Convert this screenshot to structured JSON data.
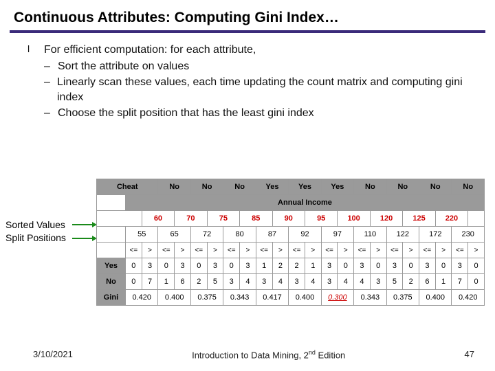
{
  "title": "Continuous Attributes: Computing Gini Index…",
  "bullet_main": "For efficient computation: for each attribute,",
  "bullets": [
    "Sort the attribute on values",
    "Linearly scan these values, each time updating the count matrix and computing gini index",
    "Choose the split position that has the least gini index"
  ],
  "labels": {
    "sorted": "Sorted Values",
    "split": "Split Positions",
    "cheat": "Cheat",
    "annual": "Annual Income",
    "yes": "Yes",
    "no": "No",
    "gini": "Gini",
    "le": "<=",
    "gt": ">"
  },
  "chart_data": {
    "type": "table",
    "cheat_row": [
      "No",
      "No",
      "No",
      "Yes",
      "Yes",
      "Yes",
      "No",
      "No",
      "No",
      "No"
    ],
    "sorted_values": [
      60,
      70,
      75,
      85,
      90,
      95,
      100,
      120,
      125,
      220
    ],
    "split_positions": [
      55,
      65,
      72,
      80,
      87,
      92,
      97,
      110,
      122,
      172,
      230
    ],
    "yes_counts": [
      [
        0,
        3
      ],
      [
        0,
        3
      ],
      [
        0,
        3
      ],
      [
        0,
        3
      ],
      [
        1,
        2
      ],
      [
        2,
        1
      ],
      [
        3,
        0
      ],
      [
        3,
        0
      ],
      [
        3,
        0
      ],
      [
        3,
        0
      ],
      [
        3,
        0
      ]
    ],
    "no_counts": [
      [
        0,
        7
      ],
      [
        1,
        6
      ],
      [
        2,
        5
      ],
      [
        3,
        4
      ],
      [
        3,
        4
      ],
      [
        3,
        4
      ],
      [
        3,
        4
      ],
      [
        4,
        3
      ],
      [
        5,
        2
      ],
      [
        6,
        1
      ],
      [
        7,
        0
      ]
    ],
    "gini": [
      0.42,
      0.4,
      0.375,
      0.343,
      0.417,
      0.4,
      0.3,
      0.343,
      0.375,
      0.4,
      0.42
    ],
    "gini_best_index": 6
  },
  "footer": {
    "date": "3/10/2021",
    "book_pre": "Introduction to Data Mining, 2",
    "book_sup": "nd",
    "book_post": " Edition",
    "page": "47"
  }
}
